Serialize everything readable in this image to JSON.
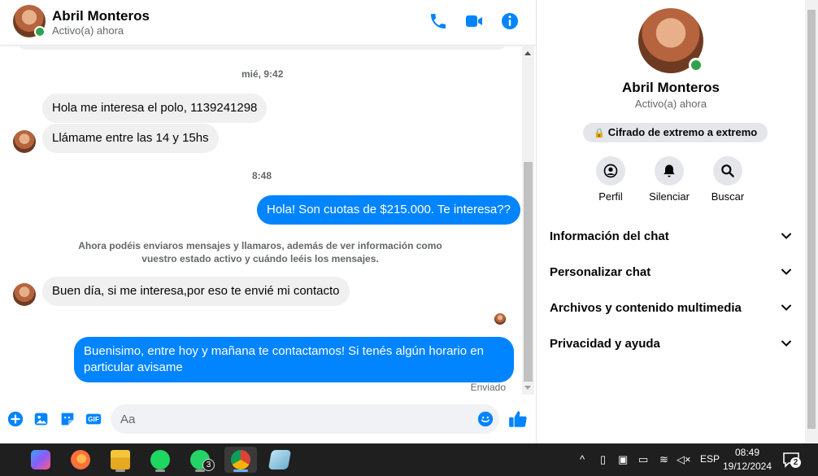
{
  "contact": {
    "name": "Abril Monteros",
    "status": "Activo(a) ahora"
  },
  "header": {
    "icons": [
      "phone-icon",
      "video-icon",
      "info-icon"
    ],
    "accent": "#0084ff"
  },
  "chat": {
    "timestamps": [
      "mié, 9:42",
      "8:48"
    ],
    "messages": [
      {
        "direction": "in",
        "text": "Hola me interesa el polo, 1139241298"
      },
      {
        "direction": "in",
        "text": "Llámame entre las 14 y 15hs"
      },
      {
        "direction": "out",
        "text": "Hola!  Son cuotas de $215.000. Te interesa??"
      },
      {
        "direction": "in",
        "text": "Buen día, si me interesa,por eso te envié mi contacto"
      },
      {
        "direction": "out",
        "text": "Buenisimo, entre hoy y mañana te contactamos! Si tenés algún horario en",
        "text2": "particular avisame"
      }
    ],
    "system_notice_line1": "Ahora podéis enviaros mensajes y llamaros, además de ver información como",
    "system_notice_line2": "vuestro estado activo y cuándo leéis los mensajes.",
    "sent_label": "Enviado"
  },
  "composer": {
    "placeholder": "Aa",
    "icons": [
      "plus-icon",
      "image-icon",
      "sticker-icon",
      "gif-icon",
      "emoji-icon",
      "like-icon"
    ]
  },
  "panel": {
    "name": "Abril Monteros",
    "status": "Activo(a) ahora",
    "encryption": "Cifrado de extremo a extremo",
    "actions": [
      {
        "label": "Perfil",
        "icon": "profile-icon"
      },
      {
        "label": "Silenciar",
        "icon": "bell-icon"
      },
      {
        "label": "Buscar",
        "icon": "search-icon"
      }
    ],
    "menu": [
      {
        "label": "Información del chat"
      },
      {
        "label": "Personalizar chat"
      },
      {
        "label": "Archivos y contenido multimedia"
      },
      {
        "label": "Privacidad y ayuda"
      }
    ]
  },
  "taskbar": {
    "apps": [
      {
        "name": "copilot-icon",
        "color": "#8a5cf6"
      },
      {
        "name": "firefox-icon",
        "color": "#ff7139"
      },
      {
        "name": "file-explorer-icon",
        "color": "#f3c43c"
      },
      {
        "name": "spotify-icon",
        "color": "#1ed760"
      },
      {
        "name": "whatsapp-icon",
        "color": "#25d366",
        "badge": "3"
      },
      {
        "name": "chrome-icon",
        "color": "#db4437"
      },
      {
        "name": "notes-icon",
        "color": "#8ec5e0"
      }
    ],
    "language": "ESP",
    "time": "08:49",
    "date": "19/12/2024",
    "notifications": "2"
  }
}
